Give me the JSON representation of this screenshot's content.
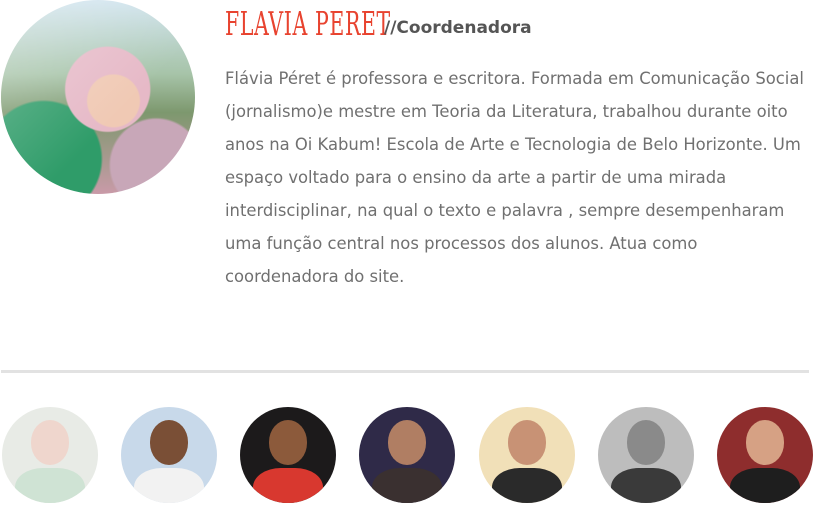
{
  "profile": {
    "name": "Flavia Peret",
    "role": "//Coordenadora",
    "bio": "Flávia Péret é professora e escritora.  Formada em Comunicação Social (jornalismo)e mestre em Teoria da Literatura, trabalhou durante oito anos na Oi Kabum! Escola de Arte e Tecnologia de Belo Horizonte. Um espaço voltado para o ensino da arte a partir de uma mirada interdisciplinar, na qual o texto e palavra , sempre desempenharam uma função central nos processos dos alunos.  Atua como coordenadora do site.",
    "colors": {
      "name": "#e8432f",
      "role": "#555555",
      "bio": "#707070",
      "divider": "#e2e2e2"
    }
  },
  "team": [
    {
      "id": "member-1",
      "bg": "#e8ebe6",
      "face": "#efd6cd",
      "body": "#cfe3d4"
    },
    {
      "id": "member-2",
      "bg": "#c8d9ea",
      "face": "#7a4f36",
      "body": "#f2f2f2"
    },
    {
      "id": "member-3",
      "bg": "#1c1a1b",
      "face": "#8c5a3b",
      "body": "#d8382f"
    },
    {
      "id": "member-4",
      "bg": "#2f2a48",
      "face": "#b07e63",
      "body": "#3a3030"
    },
    {
      "id": "member-5",
      "bg": "#f1e0b8",
      "face": "#c89275",
      "body": "#2a2a2a"
    },
    {
      "id": "member-6",
      "bg": "#bdbdbd",
      "face": "#8a8a8a",
      "body": "#3a3a3a"
    },
    {
      "id": "member-7",
      "bg": "#8e2d2d",
      "face": "#d6a184",
      "body": "#1e1e1e"
    }
  ]
}
